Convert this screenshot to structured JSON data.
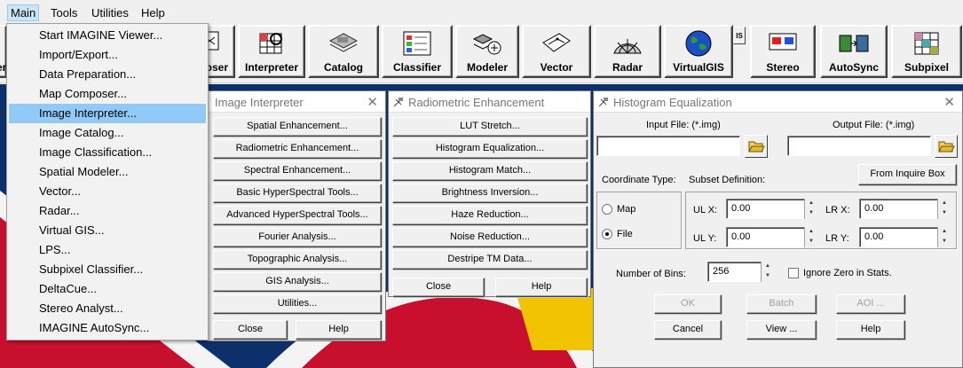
{
  "menubar": {
    "items": [
      "Main",
      "Tools",
      "Utilities",
      "Help"
    ]
  },
  "toolbar": {
    "buttons": [
      "ooser",
      "Interpreter",
      "Catalog",
      "Classifier",
      "Modeler",
      "Vector",
      "Radar",
      "VirtualGIS",
      "Stereo",
      "AutoSync",
      "Subpixel"
    ],
    "partial_left_label": "er",
    "small_button_label": "IS"
  },
  "main_menu": {
    "items": [
      "Start IMAGINE Viewer...",
      "Import/Export...",
      "Data Preparation...",
      "Map Composer...",
      "Image Interpreter...",
      "Image Catalog...",
      "Image Classification...",
      "Spatial Modeler...",
      "Vector...",
      "Radar...",
      "Virtual GIS...",
      "LPS...",
      "Subpixel Classifier...",
      "DeltaCue...",
      "Stereo Analyst...",
      "IMAGINE AutoSync..."
    ],
    "highlighted_index": 4
  },
  "image_interpreter": {
    "title": "Image Interpreter",
    "buttons": [
      "Spatial Enhancement...",
      "Radiometric Enhancement...",
      "Spectral Enhancement...",
      "Basic HyperSpectral Tools...",
      "Advanced HyperSpectral Tools...",
      "Fourier Analysis...",
      "Topographic Analysis...",
      "GIS Analysis...",
      "Utilities..."
    ],
    "close_label": "Close",
    "help_label": "Help"
  },
  "radiometric": {
    "title": "Radiometric Enhancement",
    "buttons": [
      "LUT Stretch...",
      "Histogram Equalization...",
      "Histogram Match...",
      "Brightness Inversion...",
      "Haze Reduction...",
      "Noise Reduction...",
      "Destripe TM Data..."
    ],
    "close_label": "Close",
    "help_label": "Help"
  },
  "histogram_eq": {
    "title": "Histogram Equalization",
    "input_file_label": "Input File: (*.img)",
    "output_file_label": "Output File: (*.img)",
    "input_file_value": "",
    "output_file_value": "",
    "coordinate_type_label": "Coordinate Type:",
    "subset_definition_label": "Subset Definition:",
    "from_inquire_box_label": "From Inquire Box",
    "coord_options": [
      "Map",
      "File"
    ],
    "coord_selected": "File",
    "ulx_label": "UL X:",
    "uly_label": "UL Y:",
    "lrx_label": "LR X:",
    "lry_label": "LR Y:",
    "ulx_value": "0.00",
    "uly_value": "0.00",
    "lrx_value": "0.00",
    "lry_value": "0.00",
    "bins_label": "Number of Bins:",
    "bins_value": "256",
    "ignore_zero_label": "Ignore Zero in Stats.",
    "ignore_zero_checked": false,
    "ok_label": "OK",
    "batch_label": "Batch",
    "aoi_label": "AOI ...",
    "cancel_label": "Cancel",
    "view_label": "View ...",
    "help_label": "Help"
  },
  "colors": {
    "menu_highlight": "#91c9f7",
    "background_blue": "#0d2f6b",
    "background_red": "#c8102e",
    "background_yellow": "#f2c300"
  }
}
